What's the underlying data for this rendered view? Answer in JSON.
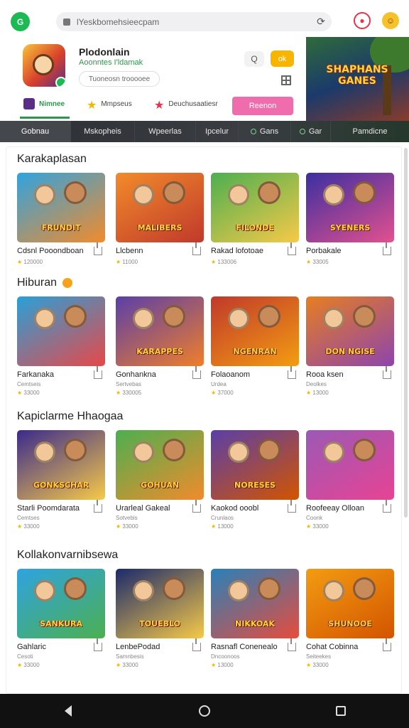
{
  "browser": {
    "url": "lYeskbomehsieecpam",
    "logo_label": "G"
  },
  "hero": {
    "title": "Plodonlain",
    "subtitle": "Aoonntes  I'ldamak",
    "tag": "Tuoneosn trooooee",
    "banner_text": "SHAPHANS GANES",
    "search_btn": "Q",
    "yellow_btn": "ok",
    "tabs": {
      "home": "Nimnee",
      "fav": "Mmpseus",
      "star": "Deuchusaatiesr",
      "cta": "Reenon"
    }
  },
  "nav": [
    "Gobnau",
    "Mskopheis",
    "Wpeerlas",
    "Ipcelur",
    "Gans",
    "Gar",
    "Pamdicne"
  ],
  "sections": [
    {
      "title": "Karakaplasan",
      "emoji": false,
      "cards": [
        {
          "name": "Cdsnl Pooondboan",
          "meta": "120000",
          "thumb_title": "FRUNDIT",
          "colors": [
            "#2fa3e0",
            "#f28b2b"
          ]
        },
        {
          "name": "Llcbenn",
          "meta": "11000",
          "thumb_title": "MALIBERS",
          "colors": [
            "#f28b2b",
            "#c0392b"
          ]
        },
        {
          "name": "Rakad lofotoae",
          "meta": "133006",
          "thumb_title": "FILONDE",
          "colors": [
            "#4caf50",
            "#f7c948"
          ]
        },
        {
          "name": "Porbakale",
          "meta": "33005",
          "thumb_title": "SYENERS",
          "colors": [
            "#3b2fa0",
            "#e3508f"
          ]
        }
      ]
    },
    {
      "title": "Hiburan",
      "emoji": true,
      "cards": [
        {
          "name": "Farkanaka",
          "meta": "33000",
          "meta_top": "Cemtseis",
          "thumb_title": "",
          "colors": [
            "#29a0d8",
            "#e84848"
          ]
        },
        {
          "name": "Gonhankna",
          "meta": "330005",
          "meta_top": "Sertvebas",
          "thumb_title": "KARAPPES",
          "colors": [
            "#5a3fa8",
            "#f07e2a"
          ]
        },
        {
          "name": "Folaoanom",
          "meta": "37000",
          "meta_top": "Urdea",
          "thumb_title": "NGENRAN",
          "colors": [
            "#c0392b",
            "#f39c12"
          ]
        },
        {
          "name": "Rooa ksen",
          "meta": "13000",
          "meta_top": "Deolkes",
          "thumb_title": "DON NGISE",
          "colors": [
            "#e67e22",
            "#8e44ad"
          ]
        }
      ]
    },
    {
      "title": "Kapiclarme Hhaogaa",
      "emoji": false,
      "cards": [
        {
          "name": "Starli Poomdarata",
          "meta": "33000",
          "meta_top": "Cemtses",
          "thumb_title": "GONKSCHAR",
          "colors": [
            "#3a2a8c",
            "#f7c948"
          ]
        },
        {
          "name": "Urarleal Gakeal",
          "meta": "33000",
          "meta_top": "Sotvebis",
          "thumb_title": "GOHUAN",
          "colors": [
            "#4caf50",
            "#f28b2b"
          ]
        },
        {
          "name": "Kaokod ooobl",
          "meta": "13000",
          "meta_top": "Crunlaos",
          "thumb_title": "NORESES",
          "colors": [
            "#5a3fa8",
            "#d35400"
          ]
        },
        {
          "name": "Roofeeay Olloan",
          "meta": "33000",
          "meta_top": "Coonk",
          "thumb_title": "",
          "colors": [
            "#9b59b6",
            "#e84393"
          ]
        }
      ]
    },
    {
      "title": "Kollakonvarnibsewa",
      "emoji": false,
      "cards": [
        {
          "name": "Gahlaric",
          "meta": "33000",
          "meta_top": "Cesoti",
          "thumb_title": "SANKURA",
          "colors": [
            "#2fa3e0",
            "#4caf50"
          ]
        },
        {
          "name": "LenbePodad",
          "meta": "33000",
          "meta_top": "Samnbesis",
          "thumb_title": "TOUEBLO",
          "colors": [
            "#1b2a6b",
            "#f7c948"
          ]
        },
        {
          "name": "Rasnafl Conenealo",
          "meta": "13000",
          "meta_top": "Dncoonoos",
          "thumb_title": "NIKKOAK",
          "colors": [
            "#2980b9",
            "#e74c3c"
          ]
        },
        {
          "name": "Cohat Cobinna",
          "meta": "33000",
          "meta_top": "Seiteekes",
          "thumb_title": "SHUNOOE",
          "colors": [
            "#f39c12",
            "#d35400"
          ]
        }
      ]
    }
  ],
  "accent": "#2a9a4a"
}
